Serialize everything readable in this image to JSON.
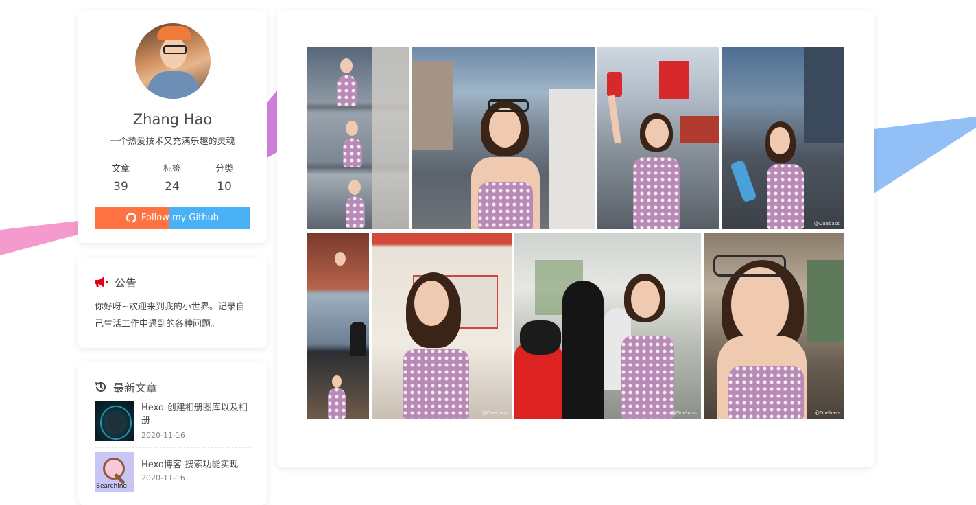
{
  "profile": {
    "name": "Zhang Hao",
    "description": "一个热爱技术又充满乐趣的灵魂",
    "stats": [
      {
        "label": "文章",
        "value": "39"
      },
      {
        "label": "标签",
        "value": "24"
      },
      {
        "label": "分类",
        "value": "10"
      }
    ],
    "follow_label": "Follow my Github",
    "follow_icon": "github-icon"
  },
  "announcement": {
    "icon": "megaphone-icon",
    "title": "公告",
    "text": "你好呀~欢迎来到我的小世界。记录自己生活工作中遇到的各种问题。"
  },
  "recent_posts": {
    "icon": "history-icon",
    "title": "最新文章",
    "items": [
      {
        "title": "Hexo-创建相册图库以及相册",
        "date": "2020-11-16"
      },
      {
        "title": "Hexo博客-搜索功能实现",
        "date": "2020-11-16",
        "thumb_text": "Searching..."
      }
    ]
  },
  "gallery": {
    "photos": [
      {
        "watermark": ""
      },
      {
        "watermark": ""
      },
      {
        "watermark": ""
      },
      {
        "watermark": "@Duebass"
      },
      {
        "watermark": ""
      },
      {
        "watermark": "@Duebass"
      },
      {
        "watermark": "@Duebass"
      },
      {
        "watermark": "@Duebass"
      }
    ]
  },
  "colors": {
    "follow_left": "#ff7242",
    "follow_right": "#49b1f5",
    "announce_icon": "#e60012",
    "decor_purple": "#c86ad6",
    "decor_pink": "#f48fc6",
    "decor_blue": "#7fb4f5"
  }
}
